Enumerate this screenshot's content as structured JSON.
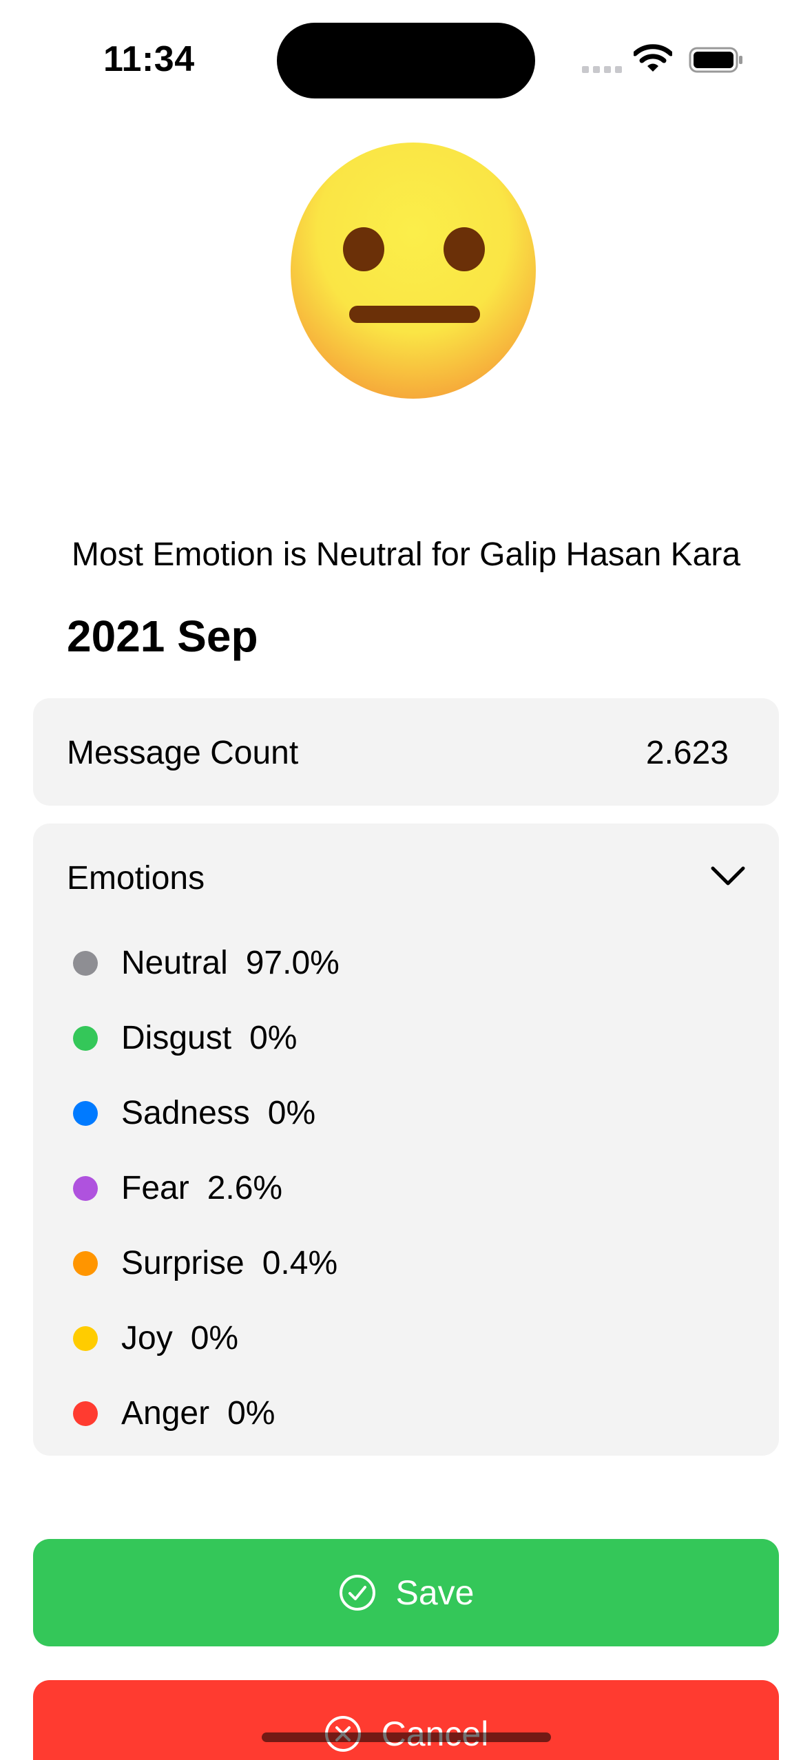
{
  "status_bar": {
    "time": "11:34"
  },
  "emoji": {
    "icon": "neutral-face-emoji"
  },
  "headline": "Most Emotion is Neutral for Galip Hasan Kara",
  "period": "2021 Sep",
  "message_count": {
    "label": "Message Count",
    "value": "2.623"
  },
  "emotions": {
    "title": "Emotions",
    "items": [
      {
        "label": "Neutral",
        "percent": "97.0%",
        "color": "#8e8e93"
      },
      {
        "label": "Disgust",
        "percent": "0%",
        "color": "#34c759"
      },
      {
        "label": "Sadness",
        "percent": "0%",
        "color": "#007aff"
      },
      {
        "label": "Fear",
        "percent": "2.6%",
        "color": "#af52de"
      },
      {
        "label": "Surprise",
        "percent": "0.4%",
        "color": "#ff9500"
      },
      {
        "label": "Joy",
        "percent": "0%",
        "color": "#ffcc00"
      },
      {
        "label": "Anger",
        "percent": "0%",
        "color": "#ff3b30"
      }
    ]
  },
  "buttons": {
    "save": {
      "label": "Save",
      "color": "#34c759"
    },
    "cancel": {
      "label": "Cancel",
      "color": "#ff3b30"
    }
  }
}
